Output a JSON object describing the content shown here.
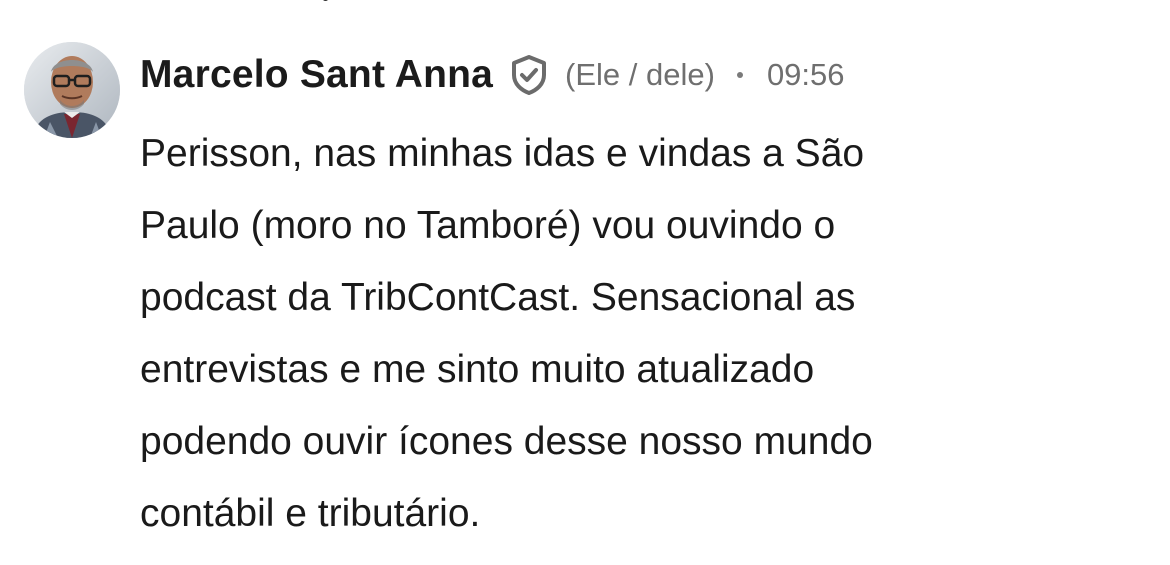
{
  "previous_message": {
    "fragment": "ç"
  },
  "comment": {
    "author": {
      "name": "Marcelo Sant Anna",
      "avatar_icon": "profile-photo",
      "badge_icon": "verified-shield-icon",
      "pronouns": "(Ele / dele)"
    },
    "separator": "•",
    "timestamp": "09:56",
    "body_lines": [
      "Perisson, nas minhas idas e vindas a São",
      "Paulo (moro no Tamboré) vou ouvindo o",
      "podcast da TribContCast. Sensacional as",
      "entrevistas e me sinto muito atualizado",
      "podendo ouvir ícones desse nosso mundo",
      "contábil e tributário."
    ]
  },
  "colors": {
    "text_primary": "#1a1a1a",
    "text_secondary": "#6f6f6f",
    "background": "#ffffff"
  }
}
